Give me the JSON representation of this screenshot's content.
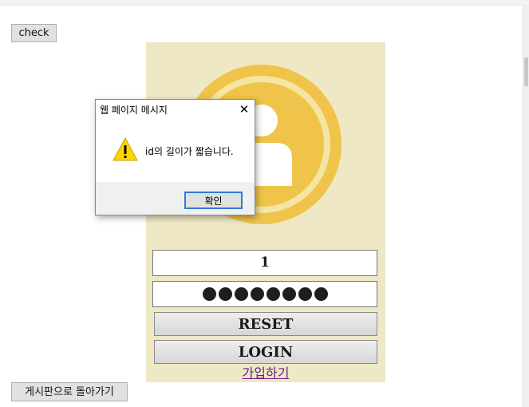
{
  "toolbar": {
    "check_label": "check"
  },
  "login": {
    "id_value": "1",
    "password_length": 8,
    "reset_label": "RESET",
    "login_label": "LOGIN",
    "join_label": "가입하기"
  },
  "footer": {
    "back_label": "게시판으로 돌아가기"
  },
  "dialog": {
    "title": "웹 페이지 메시지",
    "close_glyph": "✕",
    "message": "id의 길이가 짧습니다.",
    "ok_label": "확인",
    "icon": "warning-icon"
  },
  "colors": {
    "panel_bg": "#eee8c4",
    "avatar_gold": "#f0c44a",
    "avatar_ring": "#f4e6a2",
    "link": "#6b1f8a",
    "dialog_focus": "#2f7bd4"
  }
}
